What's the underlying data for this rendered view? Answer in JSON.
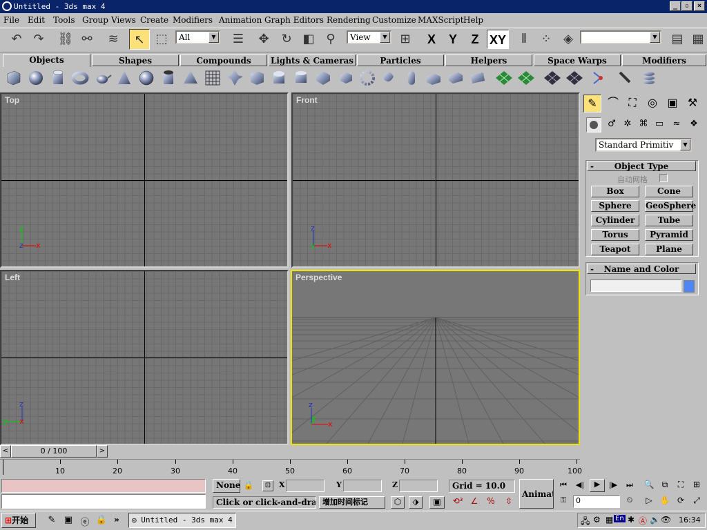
{
  "window": {
    "title": "Untitled - 3ds max 4"
  },
  "menu": [
    "File",
    "Edit",
    "Tools",
    "Group",
    "Views",
    "Create",
    "Modifiers",
    "Animation",
    "Graph Editors",
    "Rendering",
    "Customize",
    "MAXScript",
    "Help"
  ],
  "toolbar": {
    "selection_filter": "All",
    "ref_coord": "View",
    "axis_x": "X",
    "axis_y": "Y",
    "axis_z": "Z",
    "axis_xy": "XY",
    "named_sel": ""
  },
  "tabs": [
    "Objects",
    "Shapes",
    "Compounds",
    "Lights & Cameras",
    "Particles",
    "Helpers",
    "Space Warps",
    "Modifiers"
  ],
  "viewports": {
    "top": "Top",
    "front": "Front",
    "left": "Left",
    "perspective": "Perspective"
  },
  "axes": {
    "x": "x",
    "y": "y",
    "z": "z"
  },
  "command_panel": {
    "category": "Standard Primitiv",
    "object_type_title": "Object Type",
    "autogrid_label": "自动网格",
    "buttons": [
      "Box",
      "Cone",
      "Sphere",
      "GeoSphere",
      "Cylinder",
      "Tube",
      "Torus",
      "Pyramid",
      "Teapot",
      "Plane"
    ],
    "name_color_title": "Name and Color",
    "name_value": "",
    "object_color": "#4f86f7"
  },
  "time": {
    "slider_label": "0 / 100",
    "ruler_labels": [
      "10",
      "20",
      "30",
      "40",
      "50",
      "60",
      "70",
      "80",
      "90",
      "100"
    ]
  },
  "status": {
    "selection": "None",
    "x_label": "X",
    "y_label": "Y",
    "z_label": "Z",
    "x_value": "",
    "y_value": "",
    "z_value": "",
    "grid": "Grid = 10.0",
    "prompt": "Click or click-and-drag",
    "add_time_tag": "增加时间标记",
    "animate": "Animate",
    "frame": "0"
  },
  "taskbar": {
    "start": "开始",
    "task": "Untitled - 3ds max 4",
    "clock": "16:34",
    "tray_en": "En"
  }
}
